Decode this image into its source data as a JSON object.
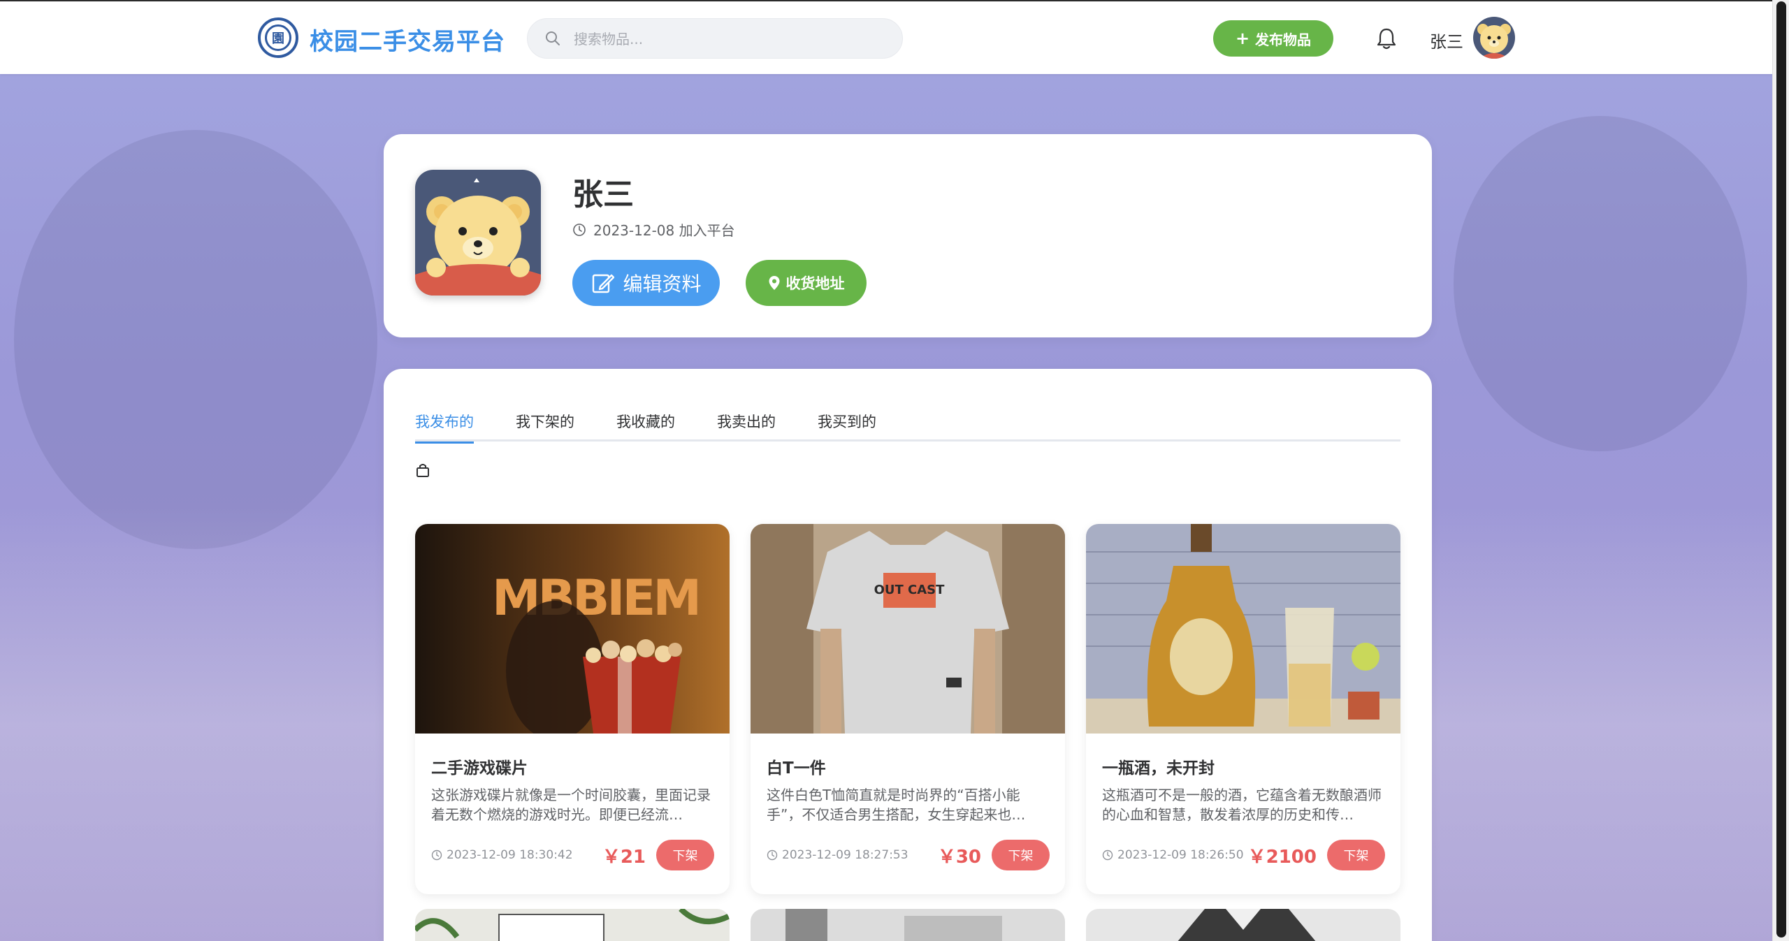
{
  "header": {
    "site_title": "校园二手交易平台",
    "logo_glyph": "園",
    "search_placeholder": "搜索物品...",
    "publish_label": "发布物品",
    "username": "张三"
  },
  "profile": {
    "name": "张三",
    "join_text": "2023-12-08 加入平台",
    "edit_label": "编辑资料",
    "address_label": "收货地址"
  },
  "tabs": [
    {
      "label": "我发布的",
      "active": true
    },
    {
      "label": "我下架的",
      "active": false
    },
    {
      "label": "我收藏的",
      "active": false
    },
    {
      "label": "我卖出的",
      "active": false
    },
    {
      "label": "我买到的",
      "active": false
    }
  ],
  "products": [
    {
      "title": "二手游戏碟片",
      "description": "这张游戏碟片就像是一个时间胶囊，里面记录着无数个燃烧的游戏时光。即便已经流…",
      "time": "2023-12-09 18:30:42",
      "price": "￥21",
      "action_label": "下架",
      "photo_text": "MBBIEM"
    },
    {
      "title": "白T一件",
      "description": "这件白色T恤简直就是时尚界的“百搭小能手”，不仅适合男生搭配，女生穿起来也…",
      "time": "2023-12-09 18:27:53",
      "price": "￥30",
      "action_label": "下架",
      "photo_text": "OUT CAST"
    },
    {
      "title": "一瓶酒，未开封",
      "description": "这瓶酒可不是一般的酒，它蕴含着无数酿酒师的心血和智慧，散发着浓厚的历史和传…",
      "time": "2023-12-09 18:26:50",
      "price": "￥2100",
      "action_label": "下架",
      "photo_text": ""
    }
  ],
  "colors": {
    "accent_blue": "#3a8ee6",
    "green": "#67b548",
    "red": "#ec6b6b",
    "price_red": "#e85a5a"
  }
}
